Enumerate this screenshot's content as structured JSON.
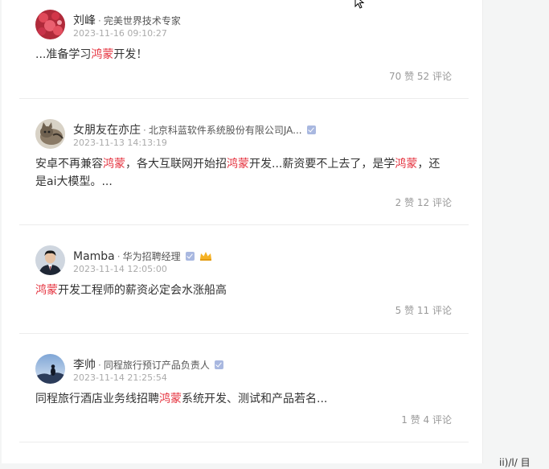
{
  "posts": [
    {
      "name": "刘峰",
      "title": "完美世界技术专家",
      "time": "2023-11-16 09:10:27",
      "content": [
        {
          "text": "...准备学习",
          "hl": false
        },
        {
          "text": "鸿蒙",
          "hl": true
        },
        {
          "text": "开发！",
          "hl": false
        }
      ],
      "likes": "70 赞",
      "comments": "52 评论",
      "verified": false,
      "crown": false,
      "avatar": "flowers-avatar"
    },
    {
      "name": "女朋友在亦庄",
      "title": "北京科蓝软件系统股份有限公司JA...",
      "time": "2023-11-13 14:13:19",
      "content": [
        {
          "text": "安卓不再兼容",
          "hl": false
        },
        {
          "text": "鸿蒙",
          "hl": true
        },
        {
          "text": "，各大互联网开始招",
          "hl": false
        },
        {
          "text": "鸿蒙",
          "hl": true
        },
        {
          "text": "开发...薪资要不上去了，是学",
          "hl": false
        },
        {
          "text": "鸿蒙",
          "hl": true
        },
        {
          "text": "，还是ai大模型。...",
          "hl": false
        }
      ],
      "likes": "2 赞",
      "comments": "12 评论",
      "verified": true,
      "crown": false,
      "avatar": "cat-avatar"
    },
    {
      "name": "Mamba",
      "title": "华为招聘经理",
      "time": "2023-11-14 12:05:00",
      "content": [
        {
          "text": "鸿蒙",
          "hl": true
        },
        {
          "text": "开发工程师的薪资必定会水涨船高",
          "hl": false
        }
      ],
      "likes": "5 赞",
      "comments": "11 评论",
      "verified": true,
      "crown": true,
      "avatar": "man-suit-avatar"
    },
    {
      "name": "李帅",
      "title": "同程旅行预订产品负责人",
      "time": "2023-11-14 21:25:54",
      "content": [
        {
          "text": "同程旅行酒店业务线招聘",
          "hl": false
        },
        {
          "text": "鸿蒙",
          "hl": true
        },
        {
          "text": "系统开发、测试和产品若名...",
          "hl": false
        }
      ],
      "likes": "1 赞",
      "comments": "4 评论",
      "verified": true,
      "crown": false,
      "avatar": "landscape-avatar"
    }
  ],
  "colors": {
    "highlight": "#e5333f",
    "badge": "#a9b8e0",
    "crown": "#f5b225"
  },
  "side_fragment": "ii)/l/ 目"
}
